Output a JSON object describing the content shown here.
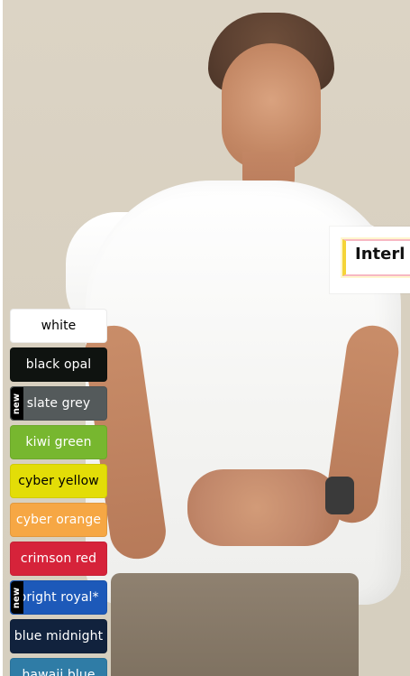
{
  "ribbon": {
    "text": "Interl",
    "colors": {
      "left": "#f5d437",
      "edge": "#f7b8c3"
    }
  },
  "swatches": [
    {
      "label": "white",
      "bg": "#ffffff",
      "fg": "#000000",
      "new": false
    },
    {
      "label": "black opal",
      "bg": "#0f1310",
      "fg": "#ffffff",
      "new": false
    },
    {
      "label": "slate grey",
      "bg": "#545a5b",
      "fg": "#ffffff",
      "new": true,
      "badge": "new"
    },
    {
      "label": "kiwi green",
      "bg": "#77b72f",
      "fg": "#ffffff",
      "new": false
    },
    {
      "label": "cyber yellow",
      "bg": "#e3dd07",
      "fg": "#000000",
      "new": false
    },
    {
      "label": "cyber orange",
      "bg": "#f6a744",
      "fg": "#ffffff",
      "new": false
    },
    {
      "label": "crimson red",
      "bg": "#d6233a",
      "fg": "#ffffff",
      "new": false
    },
    {
      "label": "bright royal*",
      "bg": "#1d59b9",
      "fg": "#ffffff",
      "new": true,
      "badge": "new"
    },
    {
      "label": "blue midnight",
      "bg": "#11223d",
      "fg": "#ffffff",
      "new": false
    },
    {
      "label": "hawaii blue",
      "bg": "#2f7ca6",
      "fg": "#ffffff",
      "new": false
    }
  ]
}
